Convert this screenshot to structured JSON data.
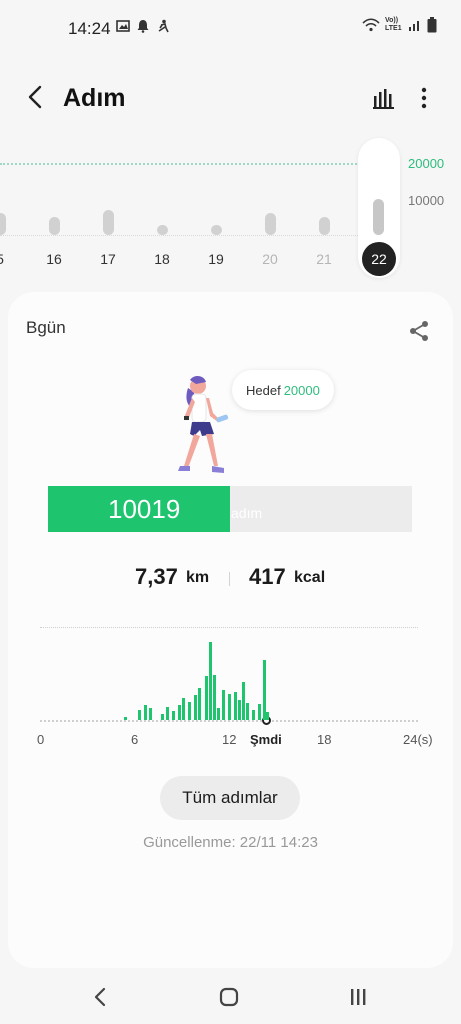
{
  "status_bar": {
    "time": "14:24",
    "left_icons": [
      "image-icon",
      "bell-icon",
      "figure-icon"
    ],
    "right_icons": [
      "wifi-icon",
      "volte-icon",
      "signal-icon",
      "battery-icon"
    ],
    "network_text": "Vo)) LTE1"
  },
  "app_bar": {
    "title": "Adım"
  },
  "day_strip": {
    "goal_value": "20000",
    "mid_value": "10000",
    "days": [
      {
        "label": "5",
        "level": 0.3,
        "dim": false
      },
      {
        "label": "16",
        "level": 0.25,
        "dim": false
      },
      {
        "label": "17",
        "level": 0.35,
        "dim": false
      },
      {
        "label": "18",
        "level": 0.1,
        "dim": false
      },
      {
        "label": "19",
        "level": 0.06,
        "dim": false
      },
      {
        "label": "20",
        "level": 0.3,
        "dim": true
      },
      {
        "label": "21",
        "level": 0.25,
        "dim": true
      }
    ],
    "selected_day": {
      "label": "22",
      "level": 0.5
    }
  },
  "card": {
    "date_label": "Bgün",
    "goal_label": "Hedef",
    "goal_value": "20000",
    "steps": "10019",
    "steps_unit": "adım",
    "progress_fraction": 0.5,
    "distance_value": "7,37",
    "distance_unit": "km",
    "calories_value": "417",
    "calories_unit": "kcal",
    "hourly_axis": {
      "labels": [
        "0",
        "6",
        "12",
        "Şmdi",
        "18",
        "24(s)"
      ]
    },
    "all_steps_button": "Tüm adımlar",
    "updated_text": "Güncellenme: 22/11 14:23"
  },
  "colors": {
    "accent_green": "#1fc46e",
    "goal_green": "#2ebd7e"
  }
}
